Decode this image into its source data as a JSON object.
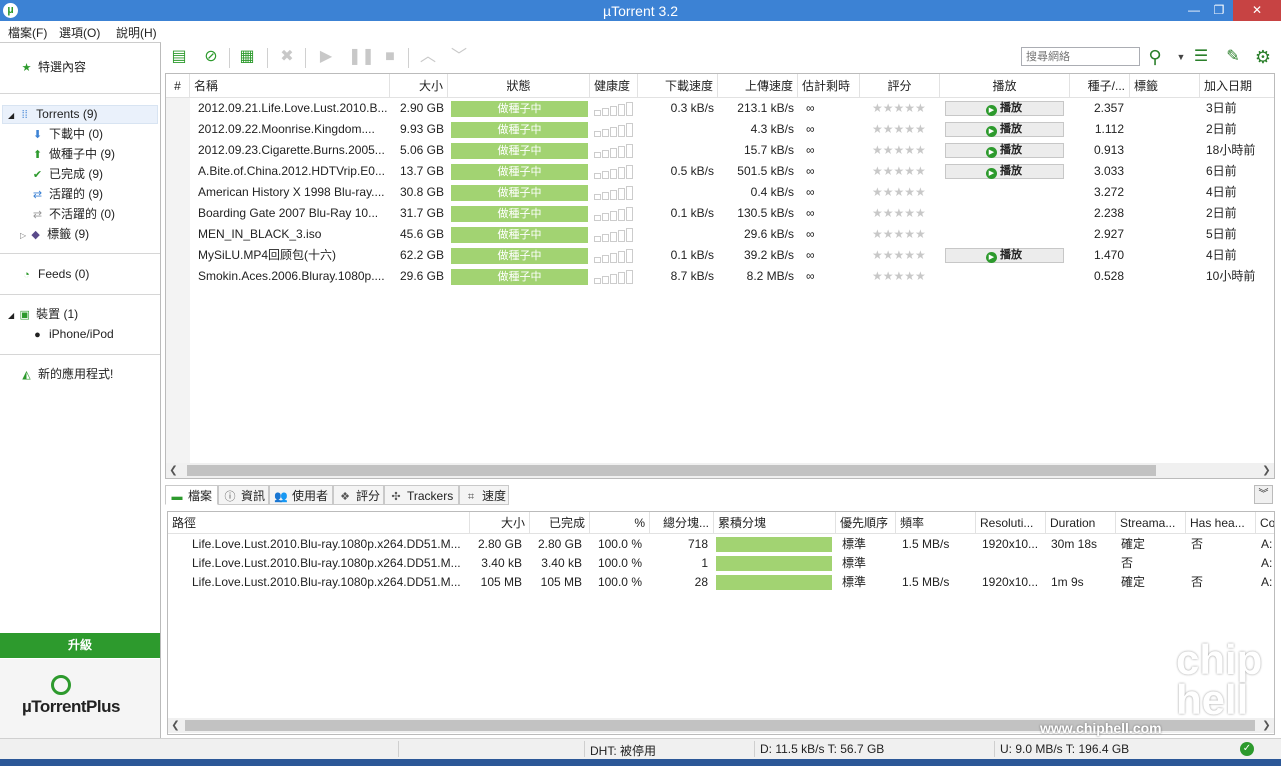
{
  "window": {
    "title": "µTorrent 3.2",
    "min": "—",
    "max": "❐",
    "close": "✕",
    "app_glyph": "µ"
  },
  "menu": [
    "檔案(F)",
    "選項(O)",
    "說明(H)"
  ],
  "sidebar": {
    "featured": "特選內容",
    "torrents": "Torrents (9)",
    "downloading": "下載中 (0)",
    "seeding": "做種子中 (9)",
    "completed": "已完成 (9)",
    "active": "活躍的 (9)",
    "inactive": "不活躍的 (0)",
    "labels": "標籤 (9)",
    "feeds": "Feeds (0)",
    "devices": "裝置 (1)",
    "iphone": "iPhone/iPod",
    "new_apps": "新的應用程式!",
    "upgrade": "升級",
    "plus_logo": "µTorrentPlus"
  },
  "toolbar": {
    "search_placeholder": "搜尋網絡"
  },
  "torrent_columns": [
    "#",
    "名稱",
    "大小",
    "狀態",
    "健康度",
    "下載速度",
    "上傳速度",
    "估計剩時",
    "評分",
    "播放",
    "種子/...",
    "標籤",
    "加入日期"
  ],
  "torrents": [
    {
      "name": "2012.09.21.Life.Love.Lust.2010.B...",
      "size": "2.90 GB",
      "status": "做種子中",
      "down": "0.3 kB/s",
      "up": "213.1 kB/s",
      "eta": "∞",
      "play": "播放",
      "ratio": "2.357",
      "added": "3日前"
    },
    {
      "name": "2012.09.22.Moonrise.Kingdom....",
      "size": "9.93 GB",
      "status": "做種子中",
      "down": "",
      "up": "4.3 kB/s",
      "eta": "∞",
      "play": "播放",
      "ratio": "1.112",
      "added": "2日前"
    },
    {
      "name": "2012.09.23.Cigarette.Burns.2005...",
      "size": "5.06 GB",
      "status": "做種子中",
      "down": "",
      "up": "15.7 kB/s",
      "eta": "∞",
      "play": "播放",
      "ratio": "0.913",
      "added": "18小時前"
    },
    {
      "name": "A.Bite.of.China.2012.HDTVrip.E0...",
      "size": "13.7 GB",
      "status": "做種子中",
      "down": "0.5 kB/s",
      "up": "501.5 kB/s",
      "eta": "∞",
      "play": "播放",
      "ratio": "3.033",
      "added": "6日前"
    },
    {
      "name": "American History X 1998 Blu-ray....",
      "size": "30.8 GB",
      "status": "做種子中",
      "down": "",
      "up": "0.4 kB/s",
      "eta": "∞",
      "play": "",
      "ratio": "3.272",
      "added": "4日前"
    },
    {
      "name": "Boarding Gate 2007 Blu-Ray 10...",
      "size": "31.7 GB",
      "status": "做種子中",
      "down": "0.1 kB/s",
      "up": "130.5 kB/s",
      "eta": "∞",
      "play": "",
      "ratio": "2.238",
      "added": "2日前"
    },
    {
      "name": "MEN_IN_BLACK_3.iso",
      "size": "45.6 GB",
      "status": "做種子中",
      "down": "",
      "up": "29.6 kB/s",
      "eta": "∞",
      "play": "",
      "ratio": "2.927",
      "added": "5日前"
    },
    {
      "name": "MySiLU.MP4回顾包(十六)",
      "size": "62.2 GB",
      "status": "做種子中",
      "down": "0.1 kB/s",
      "up": "39.2 kB/s",
      "eta": "∞",
      "play": "播放",
      "ratio": "1.470",
      "added": "4日前"
    },
    {
      "name": "Smokin.Aces.2006.Bluray.1080p....",
      "size": "29.6 GB",
      "status": "做種子中",
      "down": "8.7 kB/s",
      "up": "8.2 MB/s",
      "eta": "∞",
      "play": "",
      "ratio": "0.528",
      "added": "10小時前"
    }
  ],
  "rating_stars": "★★★★★",
  "tabs": [
    "檔案",
    "資訊",
    "使用者",
    "評分",
    "Trackers",
    "速度"
  ],
  "file_columns": [
    "路徑",
    "大小",
    "已完成",
    "%",
    "總分塊...",
    "累積分塊",
    "優先順序",
    "頻率",
    "Resoluti...",
    "Duration",
    "Streama...",
    "Has hea...",
    "Co"
  ],
  "files": [
    {
      "path": "Life.Love.Lust.2010.Blu-ray.1080p.x264.DD51.M...",
      "size": "2.80 GB",
      "done": "2.80 GB",
      "pct": "100.0 %",
      "pieces": "718",
      "priority": "標準",
      "rate": "1.5 MB/s",
      "res": "1920x10...",
      "dur": "30m 18s",
      "stream": "確定",
      "hashead": "否",
      "co": "A:"
    },
    {
      "path": "Life.Love.Lust.2010.Blu-ray.1080p.x264.DD51.M...",
      "size": "3.40 kB",
      "done": "3.40 kB",
      "pct": "100.0 %",
      "pieces": "1",
      "priority": "標準",
      "rate": "",
      "res": "",
      "dur": "",
      "stream": "否",
      "hashead": "",
      "co": "A:"
    },
    {
      "path": "Life.Love.Lust.2010.Blu-ray.1080p.x264.DD51.M...",
      "size": "105 MB",
      "done": "105 MB",
      "pct": "100.0 %",
      "pieces": "28",
      "priority": "標準",
      "rate": "1.5 MB/s",
      "res": "1920x10...",
      "dur": "1m 9s",
      "stream": "確定",
      "hashead": "否",
      "co": "A:"
    }
  ],
  "statusbar": {
    "dht": "DHT: 被停用",
    "down": "D: 11.5 kB/s T: 56.7 GB",
    "up": "U: 9.0 MB/s T: 196.4 GB"
  },
  "watermark": {
    "logo": "chip hell",
    "url": "www.chiphell.com"
  },
  "colors": {
    "accent": "#2d9a2d",
    "status_green": "#a2d372",
    "titlebar": "#3c82d4",
    "close": "#c74343"
  }
}
